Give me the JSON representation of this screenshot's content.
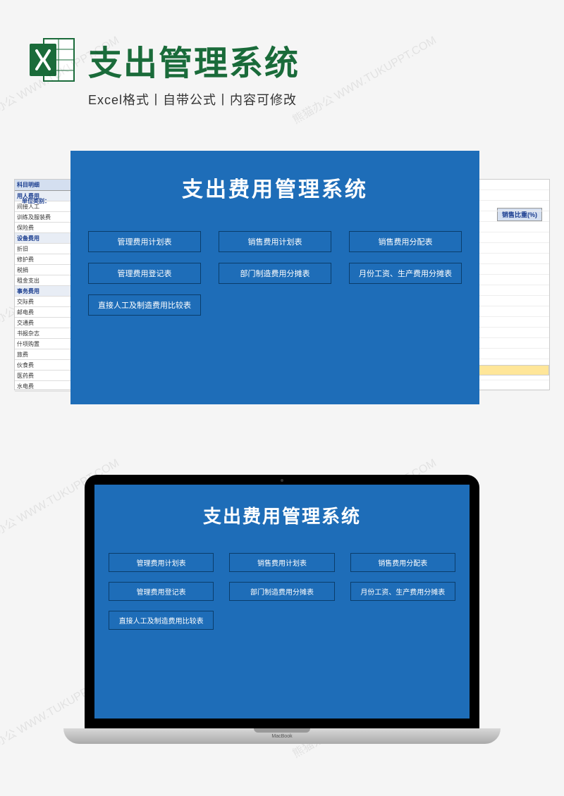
{
  "header": {
    "title": "支出管理系统",
    "subtitle": "Excel格式丨自带公式丨内容可修改"
  },
  "panel": {
    "title": "支出费用管理系统",
    "buttons": [
      "管理费用计划表",
      "销售费用计划表",
      "销售费用分配表",
      "管理费用登记表",
      "部门制造费用分摊表",
      "月份工资、生产费用分摊表",
      "直接人工及制造费用比较表"
    ]
  },
  "spreadsheet": {
    "unit_label": "单位类别：",
    "header_cell": "科目明细",
    "right_header": "销售比重(%)",
    "rows": [
      {
        "text": "用人费用",
        "bold": true
      },
      {
        "text": "间接人工",
        "bold": false
      },
      {
        "text": "训练及服装费",
        "bold": false
      },
      {
        "text": "保险费",
        "bold": false
      },
      {
        "text": "设备费用",
        "bold": true
      },
      {
        "text": "折旧",
        "bold": false
      },
      {
        "text": "修护费",
        "bold": false
      },
      {
        "text": "税捐",
        "bold": false
      },
      {
        "text": "租金支出",
        "bold": false
      },
      {
        "text": "事务费用",
        "bold": true
      },
      {
        "text": "交际费",
        "bold": false
      },
      {
        "text": "邮电费",
        "bold": false
      },
      {
        "text": "交通费",
        "bold": false
      },
      {
        "text": "书报杂志",
        "bold": false
      },
      {
        "text": "什项购置",
        "bold": false
      },
      {
        "text": "旅费",
        "bold": false
      },
      {
        "text": "伙食费",
        "bold": false
      },
      {
        "text": "医药费",
        "bold": false
      },
      {
        "text": "水电费",
        "bold": false
      }
    ]
  },
  "laptop": {
    "label": "MacBook"
  },
  "watermark": "熊猫办公 WWW.TUKUPPT.COM"
}
